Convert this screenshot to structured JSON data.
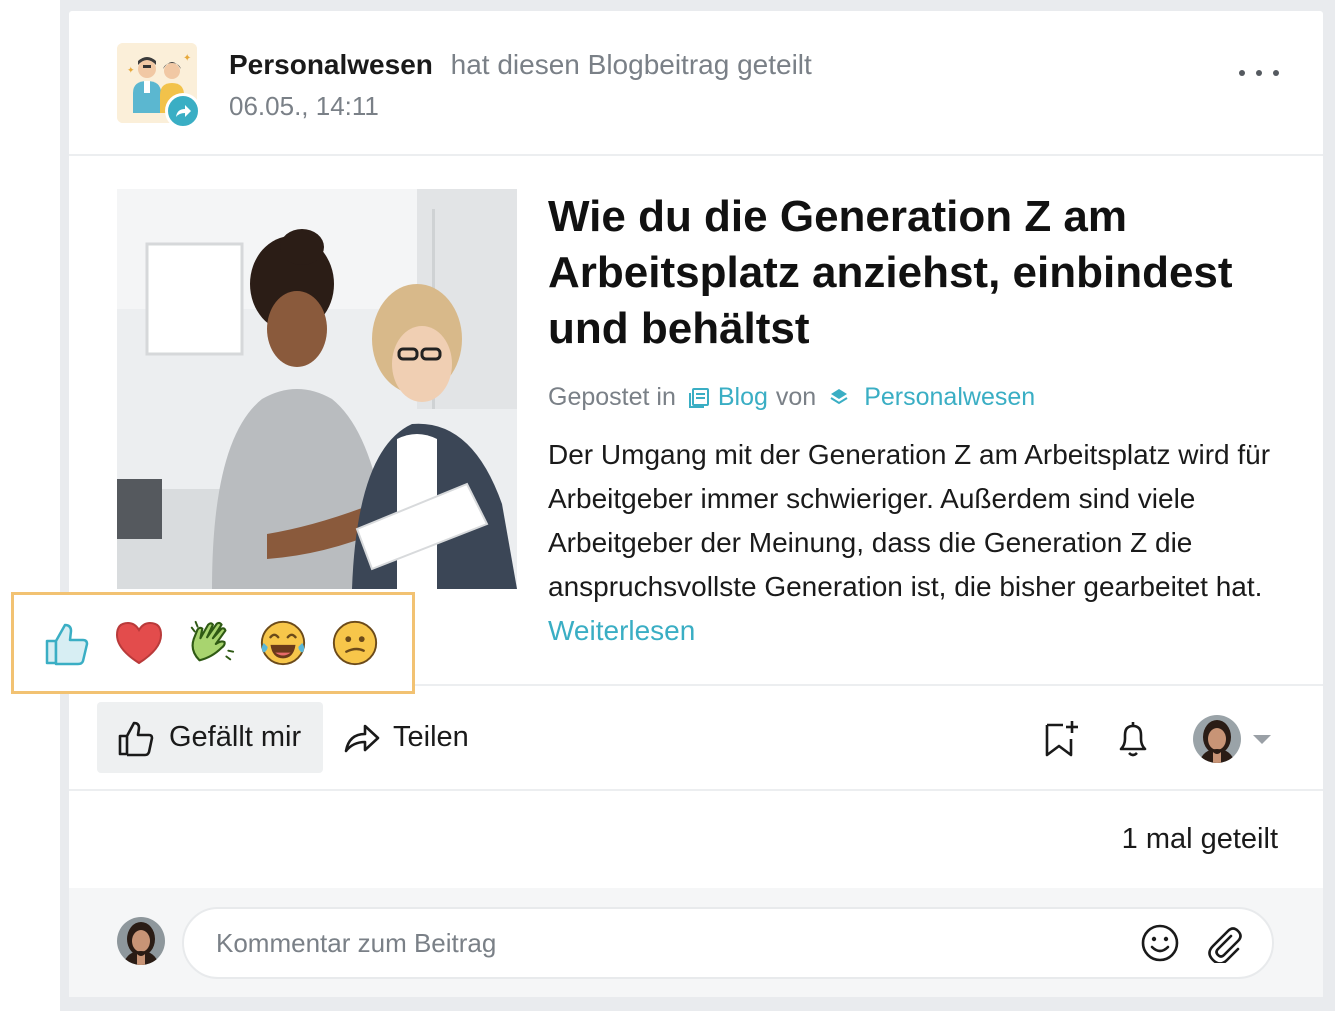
{
  "post": {
    "author": "Personalwesen",
    "action": "hat diesen Blogbeitrag  geteilt",
    "timestamp": "06.05., 14:11",
    "more_icon": "more-horizontal-icon"
  },
  "article": {
    "title": "Wie du die Generation Z am Arbeitsplatz anziehst, einbindest und behältst",
    "posted_in_label": "Gepostet in",
    "blog_link": "Blog",
    "by_label": "von",
    "space_link": "Personalwesen",
    "excerpt": "Der Umgang mit der Generation Z am Arbeitsplatz wird für Arbeitgeber immer schwieriger. Außerdem sind viele Arbeitgeber der Meinung, dass die Generation Z die anspruchsvollste Generation ist, die bisher gearbeitet hat.",
    "read_more": "Weiterlesen"
  },
  "reactions": [
    "like-icon",
    "heart-icon",
    "clap-icon",
    "laughing-icon",
    "confused-icon"
  ],
  "actions": {
    "like_label": "Gefällt mir",
    "share_label": "Teilen"
  },
  "shares": {
    "count_label": "1 mal geteilt"
  },
  "comment": {
    "placeholder": "Kommentar zum Beitrag"
  },
  "colors": {
    "accent": "#3aaec4",
    "highlight_border": "#f2c272",
    "heart": "#e34c4c"
  }
}
